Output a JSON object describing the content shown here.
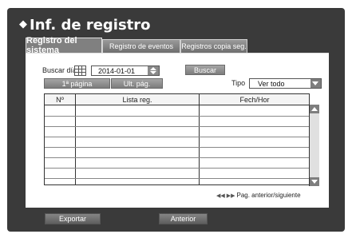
{
  "window": {
    "title": "Inf. de registro"
  },
  "tabs": [
    {
      "label": "Registro del sistema",
      "active": true
    },
    {
      "label": "Registro de eventos",
      "active": false
    },
    {
      "label": "Registros copia seg.",
      "active": false
    }
  ],
  "search": {
    "label": "Buscar día",
    "date_value": "2014-01-01",
    "search_button": "Buscar"
  },
  "nav": {
    "first_page": "1ª página",
    "last_page": "Ult. pág."
  },
  "filter": {
    "type_label": "Tipo",
    "type_value": "Ver todo"
  },
  "table": {
    "columns": [
      "Nº",
      "Lista reg.",
      "Fech/Hor"
    ],
    "rows": []
  },
  "pager": {
    "text": "Pag. anterior/siguiente"
  },
  "footer": {
    "export_button": "Exportar",
    "back_button": "Anterior"
  },
  "colors": {
    "frame_bg": "#3a3a3a",
    "button_gray": "#8a8a8a"
  }
}
